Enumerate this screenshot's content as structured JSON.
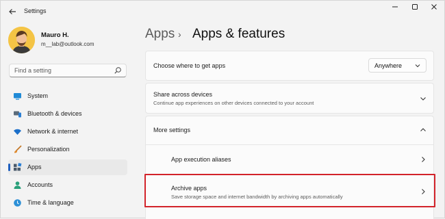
{
  "window": {
    "title": "Settings"
  },
  "profile": {
    "name": "Mauro H.",
    "email": "m__lab@outlook.com"
  },
  "search": {
    "placeholder": "Find a setting"
  },
  "sidebar": {
    "items": [
      {
        "label": "System",
        "icon": "monitor-icon"
      },
      {
        "label": "Bluetooth & devices",
        "icon": "bluetooth-devices-icon"
      },
      {
        "label": "Network & internet",
        "icon": "wifi-icon"
      },
      {
        "label": "Personalization",
        "icon": "brush-icon"
      },
      {
        "label": "Apps",
        "icon": "apps-icon",
        "selected": true
      },
      {
        "label": "Accounts",
        "icon": "person-icon"
      },
      {
        "label": "Time & language",
        "icon": "globe-clock-icon"
      }
    ]
  },
  "header": {
    "parent": "Apps",
    "separator": "›",
    "current": "Apps & features"
  },
  "settings": {
    "get_apps": {
      "title": "Choose where to get apps",
      "value": "Anywhere"
    },
    "share": {
      "title": "Share across devices",
      "description": "Continue app experiences on other devices connected to your account"
    },
    "more": {
      "title": "More settings"
    },
    "aliases": {
      "title": "App execution aliases"
    },
    "archive": {
      "title": "Archive apps",
      "description": "Save storage space and internet bandwidth by archiving apps automatically"
    }
  },
  "colors": {
    "accent": "#1f5fbf",
    "highlight": "#d2232a"
  }
}
